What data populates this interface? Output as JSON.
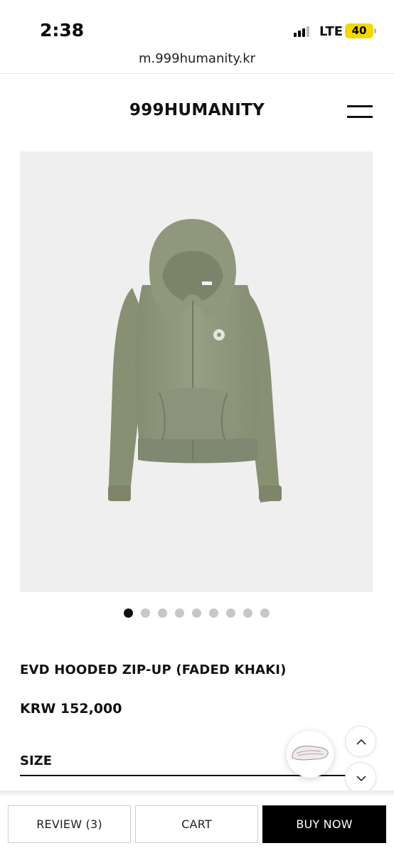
{
  "status_bar": {
    "time": "2:38",
    "network": "LTE",
    "battery": "40"
  },
  "browser": {
    "url": "m.999humanity.kr"
  },
  "header": {
    "brand": "999HUMANITY",
    "menu_icon": "hamburger-menu-icon"
  },
  "gallery": {
    "image_count": 9,
    "active_index": 0,
    "colors": {
      "background": "#efefef",
      "garment": "#8f977c"
    }
  },
  "product": {
    "name": "EVD HOODED ZIP-UP (FADED KHAKI)",
    "price": "KRW 152,000",
    "size_label": "SIZE"
  },
  "floating": {
    "scroll_up_icon": "chevron-up-icon",
    "scroll_down_icon": "chevron-down-icon",
    "thumbnail_icon": "shoe-thumbnail-icon"
  },
  "actions": {
    "review": "REVIEW (3)",
    "cart": "CART",
    "buy_now": "BUY NOW"
  },
  "colors": {
    "accent": "#000000",
    "battery": "#f1d900"
  }
}
